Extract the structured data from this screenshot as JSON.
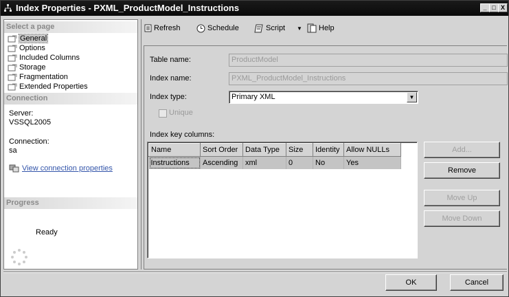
{
  "window": {
    "title": "Index Properties - PXML_ProductModel_Instructions",
    "minimize": "_",
    "restore": "□",
    "close": "X"
  },
  "sidebar": {
    "select_page_header": "Select a page",
    "pages": [
      {
        "label": "General",
        "icon": "page-wrench-icon",
        "selected": true
      },
      {
        "label": "Options",
        "icon": "page-wrench-icon"
      },
      {
        "label": "Included Columns",
        "icon": "page-wrench-icon"
      },
      {
        "label": "Storage",
        "icon": "page-wrench-icon"
      },
      {
        "label": "Fragmentation",
        "icon": "page-wrench-icon"
      },
      {
        "label": "Extended Properties",
        "icon": "page-wrench-icon"
      }
    ],
    "connection_header": "Connection",
    "server_label": "Server:",
    "server_value": "VSSQL2005",
    "connection_label": "Connection:",
    "connection_value": "sa",
    "view_connection_link": "View connection properties",
    "progress_header": "Progress",
    "progress_status": "Ready"
  },
  "toolbar": {
    "refresh": "Refresh",
    "schedule": "Schedule",
    "script": "Script",
    "help": "Help"
  },
  "form": {
    "table_name_label": "Table name:",
    "table_name_value": "ProductModel",
    "index_name_label": "Index name:",
    "index_name_value": "PXML_ProductModel_Instructions",
    "index_type_label": "Index type:",
    "index_type_value": "Primary XML",
    "unique_label": "Unique",
    "key_columns_label": "Index key columns:"
  },
  "grid": {
    "columns": [
      "Name",
      "Sort Order",
      "Data Type",
      "Size",
      "Identity",
      "Allow NULLs"
    ],
    "rows": [
      [
        "Instructions",
        "Ascending",
        "xml",
        "0",
        "No",
        "Yes"
      ]
    ]
  },
  "buttons": {
    "add": "Add...",
    "remove": "Remove",
    "move_up": "Move Up",
    "move_down": "Move Down",
    "ok": "OK",
    "cancel": "Cancel"
  }
}
